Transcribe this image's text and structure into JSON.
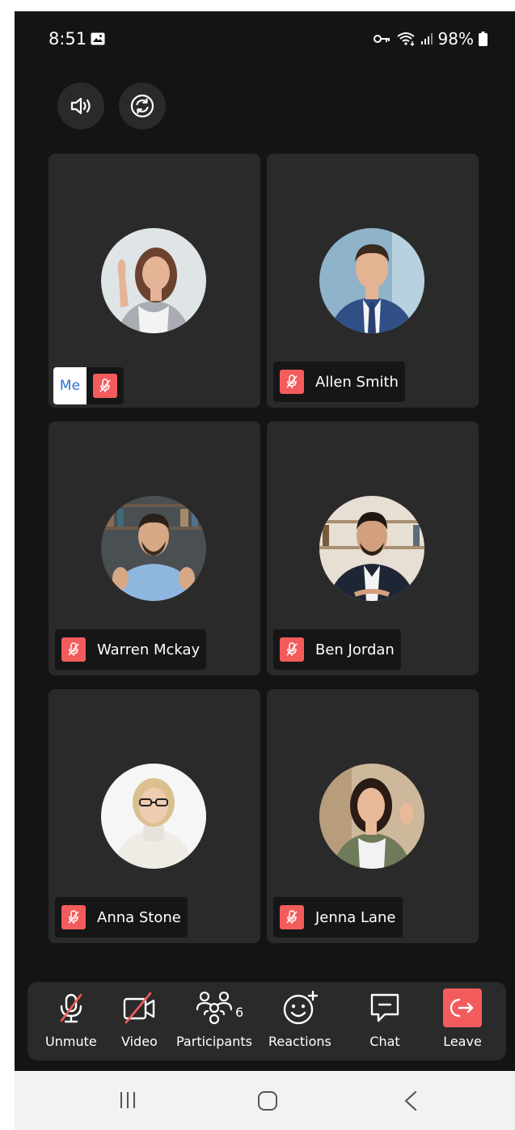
{
  "status_bar": {
    "time": "8:51",
    "battery": "98%",
    "icons": [
      "image-icon",
      "vpn-key-icon",
      "wifi-icon",
      "signal-icon",
      "battery-icon"
    ]
  },
  "top_controls": {
    "icons": [
      "speaker-icon",
      "switch-camera-icon"
    ]
  },
  "participants": [
    {
      "name": "",
      "self_label": "Me",
      "muted": true
    },
    {
      "name": "Allen Smith",
      "muted": true
    },
    {
      "name": "Warren Mckay",
      "muted": true
    },
    {
      "name": "Ben Jordan",
      "muted": true
    },
    {
      "name": "Anna Stone",
      "muted": true
    },
    {
      "name": "Jenna Lane",
      "muted": true
    }
  ],
  "toolbar": {
    "unmute_label": "Unmute",
    "video_label": "Video",
    "participants_label": "Participants",
    "participants_count": "6",
    "reactions_label": "Reactions",
    "chat_label": "Chat",
    "leave_label": "Leave"
  },
  "colors": {
    "background": "#141414",
    "tile": "#2a2a2a",
    "muted_badge": "#f35c5c",
    "leave": "#f35c5c",
    "me_text": "#2a6fd6",
    "navbar": "#f2f2f2"
  }
}
